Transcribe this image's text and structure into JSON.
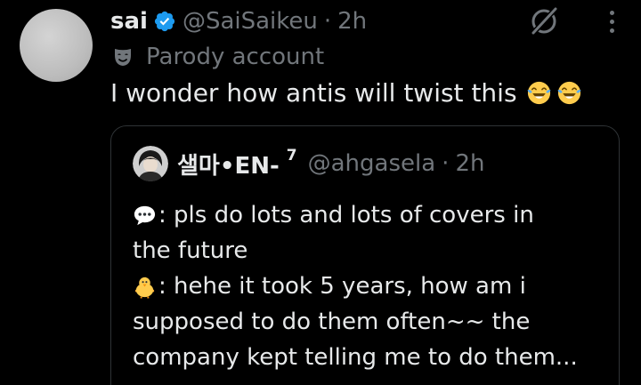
{
  "tweet": {
    "author_name": "sai",
    "handle": "@SaiSaikeu",
    "separator": "·",
    "time": "2h",
    "parody_label": "Parody account",
    "text": "I wonder how antis will twist this",
    "emoji": [
      "face-with-tears-of-joy",
      "face-with-tears-of-joy"
    ]
  },
  "quote": {
    "author_name": "샐마•EN-",
    "superscript": "7",
    "handle": "@ahgasela",
    "separator": "·",
    "time": "2h",
    "lines": [
      {
        "emoji": "speech-bubble",
        "text": ": pls do lots and lots of covers in"
      },
      {
        "emoji": null,
        "text": "the future"
      },
      {
        "emoji": "baby-chick",
        "text": ": hehe it took 5 years, how am i"
      },
      {
        "emoji": null,
        "text": "supposed to do them often~~ the"
      },
      {
        "emoji": null,
        "text": "company kept telling me to do them..."
      }
    ]
  },
  "colors": {
    "background": "#000000",
    "text_primary": "#e7e9ea",
    "text_secondary": "#71767b",
    "verified_blue": "#1d9bf0",
    "border": "#2f3336"
  }
}
